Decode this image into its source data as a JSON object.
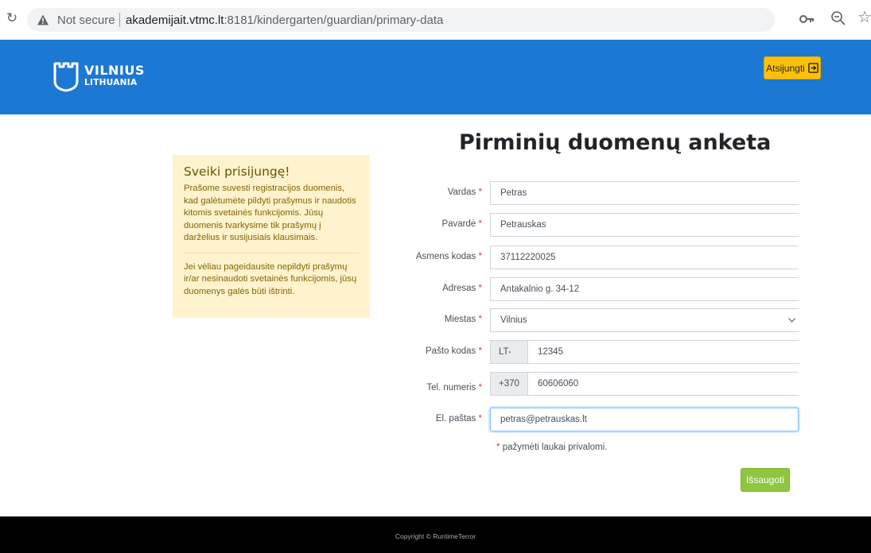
{
  "browser": {
    "not_secure": "Not secure",
    "url_host": "akademijait.vtmc.lt",
    "url_path": ":8181/kindergarten/guardian/primary-data"
  },
  "header": {
    "logo_line1": "VILNIUS",
    "logo_line2": "LITHUANIA",
    "logout_label": "Atsijungti",
    "brand_color": "#1c78d3"
  },
  "page": {
    "title": "Pirminių duomenų anketa"
  },
  "welcome": {
    "heading": "Sveiki prisijungę!",
    "text1": "Prašome suvesti registracijos duomenis, kad galėtumėte pildyti prašymus ir naudotis kitomis svetainės funkcijomis. Jūsų duomenis tvarkysime tik prašymų į darželius ir susijusiais klausimais.",
    "text2": "Jei vėliau pageidausite nepildyti prašymų ir/ar nesinaudoti svetainės funkcijomis, jūsų duomenys galės būti ištrinti."
  },
  "form": {
    "required_mark": "*",
    "first_name": {
      "label": "Vardas",
      "value": "Petras"
    },
    "last_name": {
      "label": "Pavardė",
      "value": "Petrauskas"
    },
    "personal_code": {
      "label": "Asmens kodas",
      "value": "37112220025"
    },
    "address": {
      "label": "Adresas",
      "value": "Antakalnio g. 34-12"
    },
    "city": {
      "label": "Miestas",
      "value": "Vilnius"
    },
    "postal_code": {
      "label": "Pašto kodas",
      "prefix": "LT-",
      "value": "12345"
    },
    "phone": {
      "label": "Tel. numeris",
      "prefix": "+370",
      "value": "60606060"
    },
    "email": {
      "label": "El. paštas",
      "value": "petras@petrauskas.lt"
    },
    "note": "pažymėti laukai privalomi.",
    "save_label": "Išsaugoti"
  },
  "footer": {
    "copyright": "Copyright © RuntimeTerror"
  },
  "colors": {
    "logout_button": "#ffc107",
    "save_button": "#8ec63f",
    "welcome_bg": "#fff3cd",
    "required": "#dc3545"
  },
  "icons": [
    "reload-icon",
    "warning-icon",
    "key-icon",
    "zoom-icon",
    "star-icon",
    "logout-icon",
    "chevron-down-icon"
  ]
}
